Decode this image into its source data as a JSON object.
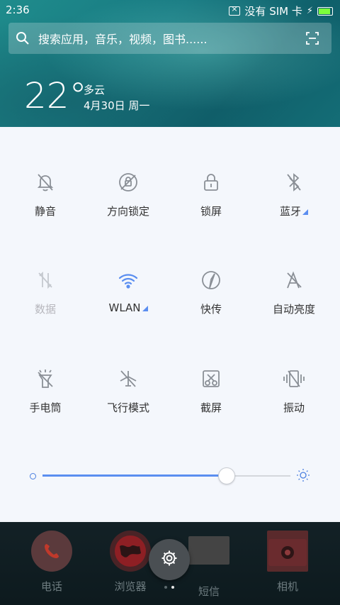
{
  "status_bar": {
    "time": "2:36",
    "sim_status": "没有 SIM 卡",
    "battery_level": 0.8
  },
  "search": {
    "placeholder": "搜索应用，音乐，视频，图书......"
  },
  "weather": {
    "temperature": "22°",
    "condition": "多云",
    "date": "4月30日 周一"
  },
  "quick_settings": {
    "tiles": [
      {
        "label": "静音",
        "icon": "bell-off-icon"
      },
      {
        "label": "方向锁定",
        "icon": "rotation-lock-icon"
      },
      {
        "label": "锁屏",
        "icon": "lock-icon"
      },
      {
        "label": "蓝牙",
        "icon": "bluetooth-icon"
      },
      {
        "label": "数据",
        "icon": "mobile-data-icon"
      },
      {
        "label": "WLAN",
        "icon": "wifi-icon"
      },
      {
        "label": "快传",
        "icon": "quick-transfer-icon"
      },
      {
        "label": "自动亮度",
        "icon": "auto-brightness-icon"
      },
      {
        "label": "手电筒",
        "icon": "flashlight-icon"
      },
      {
        "label": "飞行模式",
        "icon": "airplane-icon"
      },
      {
        "label": "截屏",
        "icon": "screenshot-icon"
      },
      {
        "label": "振动",
        "icon": "vibrate-icon"
      }
    ],
    "brightness": 0.74
  },
  "dock": {
    "apps": [
      {
        "label": "电话"
      },
      {
        "label": "浏览器"
      },
      {
        "label": "短信"
      },
      {
        "label": "相机"
      }
    ]
  },
  "colors": {
    "accent": "#5a8ef0",
    "panel_bg": "#f4f7fc"
  }
}
